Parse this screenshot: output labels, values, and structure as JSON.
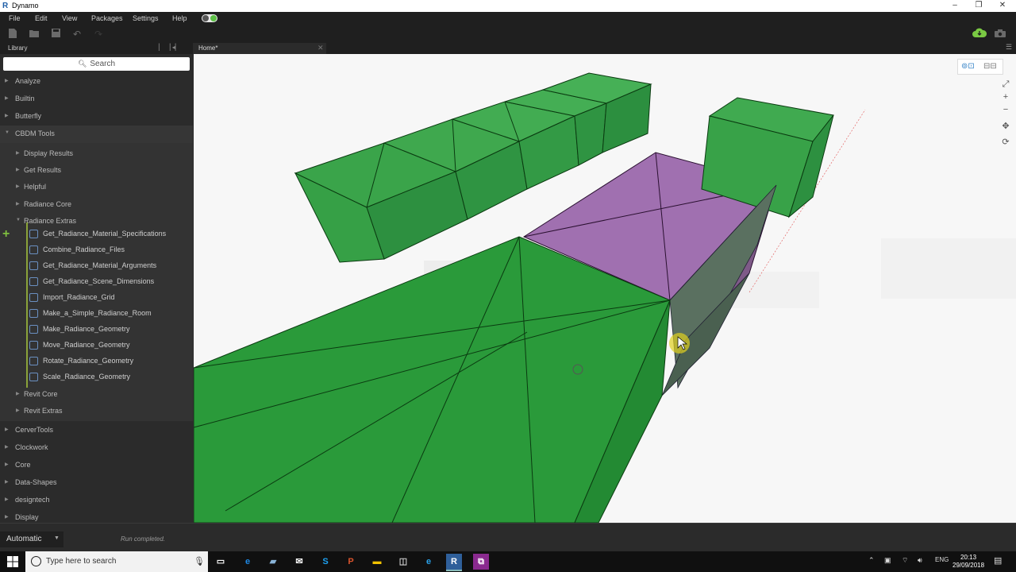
{
  "window": {
    "title": "Dynamo",
    "logo": "R",
    "buttons": [
      "–",
      "❐",
      "✕"
    ]
  },
  "menu": [
    "File",
    "Edit",
    "View",
    "Packages",
    "Settings",
    "Help"
  ],
  "toolbar": {
    "icons": [
      "new-file-icon",
      "open-folder-icon",
      "save-icon",
      "undo-icon",
      "redo-icon",
      "cloud-icon",
      "camera-icon"
    ],
    "cloud_color": "#7ac943"
  },
  "library": {
    "title": "Library",
    "search_placeholder": "Search",
    "categories_top": [
      "Analyze",
      "Builtin",
      "Butterfly",
      "CBDM Tools"
    ],
    "cbdm_subs": [
      "Display Results",
      "Get Results",
      "Helpful",
      "Radiance Core",
      "Radiance Extras"
    ],
    "radiance_extras_nodes": [
      "Get_Radiance_Material_Specifications",
      "Combine_Radiance_Files",
      "Get_Radiance_Material_Arguments",
      "Get_Radiance_Scene_Dimensions",
      "Import_Radiance_Grid",
      "Make_a_Simple_Radiance_Room",
      "Make_Radiance_Geometry",
      "Move_Radiance_Geometry",
      "Rotate_Radiance_Geometry",
      "Scale_Radiance_Geometry"
    ],
    "cbdm_subs_after": [
      "Revit Core",
      "Revit Extras"
    ],
    "categories_bottom": [
      "CerverTools",
      "Clockwork",
      "Core",
      "Data-Shapes",
      "designtech",
      "Display"
    ]
  },
  "workspace": {
    "tab_label": "Home*",
    "close": "✕"
  },
  "canvas": {
    "geometry_green": "#2a9a3a",
    "geometry_purple": "#a070b0",
    "nav_icons": [
      "zoom-fit-icon",
      "zoom-in-icon",
      "zoom-out-icon",
      "pan-icon",
      "orbit-icon"
    ]
  },
  "status": {
    "run_mode": "Automatic",
    "run_status": "Run completed."
  },
  "taskbar": {
    "search_placeholder": "Type here to search",
    "apps": [
      "task-view-icon",
      "edge-icon",
      "notepad-icon",
      "mail-icon",
      "skype-icon",
      "powerpoint-icon",
      "file-explorer-icon",
      "store-icon",
      "ie-icon",
      "revit-icon",
      "dynamo-icon"
    ],
    "lang": "ENG",
    "time": "20:13",
    "date": "29/09/2018"
  }
}
